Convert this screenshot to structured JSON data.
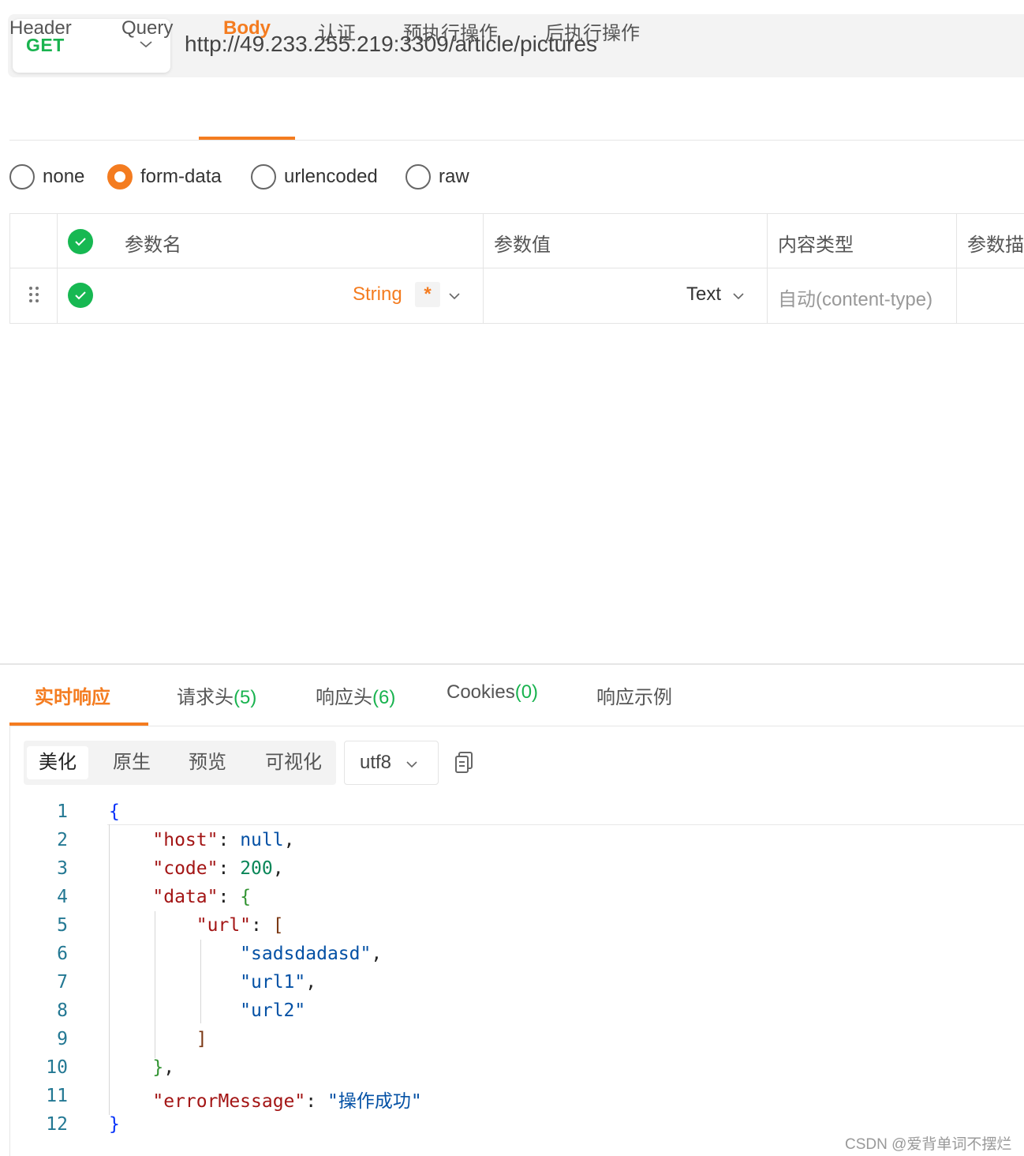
{
  "request": {
    "method": "GET",
    "url": "http://49.233.255.219:3309/article/pictures"
  },
  "request_tabs": [
    "Header",
    "Query",
    "Body",
    "认证",
    "预执行操作",
    "后执行操作"
  ],
  "active_request_tab": "Body",
  "body_types": [
    "none",
    "form-data",
    "urlencoded",
    "raw"
  ],
  "selected_body_type": "form-data",
  "params_table": {
    "headers": [
      "参数名",
      "参数值",
      "内容类型",
      "参数描"
    ],
    "row": {
      "name_type": "String",
      "required_mark": "*",
      "value_type": "Text",
      "content_type_placeholder": "自动(content-type)"
    }
  },
  "response_tabs": [
    {
      "label": "实时响应",
      "count": ""
    },
    {
      "label": "请求头",
      "count": "(5)"
    },
    {
      "label": "响应头",
      "count": "(6)"
    },
    {
      "label": "Cookies",
      "count": "(0)"
    },
    {
      "label": "响应示例",
      "count": ""
    }
  ],
  "active_response_tab": "实时响应",
  "view_modes": [
    "美化",
    "原生",
    "预览",
    "可视化"
  ],
  "active_view_mode": "美化",
  "encoding": "utf8",
  "line_numbers": [
    "1",
    "2",
    "3",
    "4",
    "5",
    "6",
    "7",
    "8",
    "9",
    "10",
    "11",
    "12"
  ],
  "response_json": {
    "host_key": "\"host\"",
    "host_value": "null",
    "code_key": "\"code\"",
    "code_value": "200",
    "data_key": "\"data\"",
    "url_key": "\"url\"",
    "url_items": [
      "\"sadsdadasd\"",
      "\"url1\"",
      "\"url2\""
    ],
    "error_key": "\"errorMessage\"",
    "error_value": "\"操作成功\""
  },
  "watermark": "CSDN @爱背单词不摆烂",
  "colors": {
    "accent": "#f47c20",
    "method_green": "#19b34f",
    "check_green": "#17b852"
  }
}
